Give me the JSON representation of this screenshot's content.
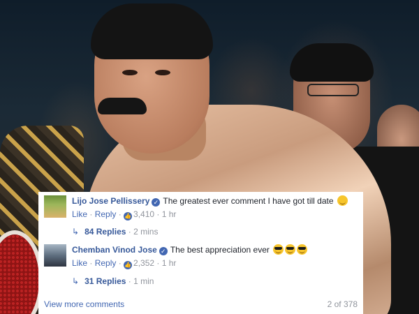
{
  "comments": [
    {
      "author": "Lijo Jose Pellissery",
      "text": "The greatest ever comment I have got till date",
      "emoji": "smiling-face-icon",
      "like_label": "Like",
      "reply_label": "Reply",
      "like_count": "3,410",
      "time": "1 hr",
      "replies_label": "84 Replies",
      "replies_time": "2 mins"
    },
    {
      "author": "Chemban Vinod Jose",
      "text": "The best appreciation ever",
      "emoji": "sunglasses-face-icon",
      "like_label": "Like",
      "reply_label": "Reply",
      "like_count": "2,352",
      "time": "1 hr",
      "replies_label": "31 Replies",
      "replies_time": "1 min"
    }
  ],
  "footer": {
    "view_more": "View more comments",
    "pager": "2 of 378"
  },
  "colors": {
    "link": "#4267b2",
    "author": "#365899",
    "muted": "#90949c"
  }
}
